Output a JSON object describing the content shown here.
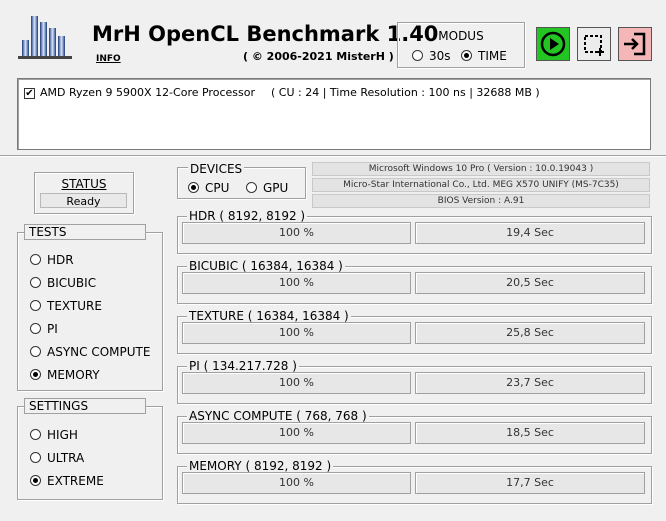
{
  "app": {
    "title": "MrH OpenCL Benchmark 1.40",
    "info_link": "INFO",
    "copyright": "( © 2006-2021 MisterH )"
  },
  "modus": {
    "title": "MODUS",
    "options": [
      {
        "label": "30s",
        "selected": false
      },
      {
        "label": "TIME",
        "selected": true
      }
    ]
  },
  "toolbar": {
    "play_icon": "play-circle-icon",
    "select_icon": "selection-icon",
    "exit_icon": "exit-icon",
    "colors": {
      "play": "#22c522",
      "exit": "#f4b6b6"
    }
  },
  "processor": {
    "checked": true,
    "name": "AMD Ryzen 9 5900X 12-Core Processor",
    "details": "( CU : 24 | Time Resolution : 100 ns | 32688 MB )"
  },
  "status": {
    "title": "STATUS",
    "value": "Ready"
  },
  "tests": {
    "title": "TESTS",
    "items": [
      {
        "label": "HDR",
        "selected": false
      },
      {
        "label": "BICUBIC",
        "selected": false
      },
      {
        "label": "TEXTURE",
        "selected": false
      },
      {
        "label": "PI",
        "selected": false
      },
      {
        "label": "ASYNC COMPUTE",
        "selected": false
      },
      {
        "label": "MEMORY",
        "selected": true
      }
    ]
  },
  "settings": {
    "title": "SETTINGS",
    "items": [
      {
        "label": "HIGH",
        "selected": false
      },
      {
        "label": "ULTRA",
        "selected": false
      },
      {
        "label": "EXTREME",
        "selected": true
      }
    ]
  },
  "devices": {
    "title": "DEVICES",
    "options": [
      {
        "label": "CPU",
        "selected": true
      },
      {
        "label": "GPU",
        "selected": false
      }
    ]
  },
  "system_info": [
    "Microsoft Windows 10 Pro ( Version : 10.0.19043 )",
    "Micro-Star International Co., Ltd. MEG X570 UNIFY (MS-7C35)",
    "BIOS Version : A.91"
  ],
  "benchmarks": [
    {
      "title": "HDR ( 8192, 8192 )",
      "percent": "100 %",
      "time": "19,4 Sec"
    },
    {
      "title": "BICUBIC ( 16384, 16384 )",
      "percent": "100 %",
      "time": "20,5 Sec"
    },
    {
      "title": "TEXTURE ( 16384, 16384 )",
      "percent": "100 %",
      "time": "25,8 Sec"
    },
    {
      "title": "PI ( 134.217.728 )",
      "percent": "100 %",
      "time": "23,7 Sec"
    },
    {
      "title": "ASYNC COMPUTE ( 768, 768 )",
      "percent": "100 %",
      "time": "18,5 Sec"
    },
    {
      "title": "MEMORY ( 8192, 8192 )",
      "percent": "100 %",
      "time": "17,7 Sec"
    }
  ]
}
